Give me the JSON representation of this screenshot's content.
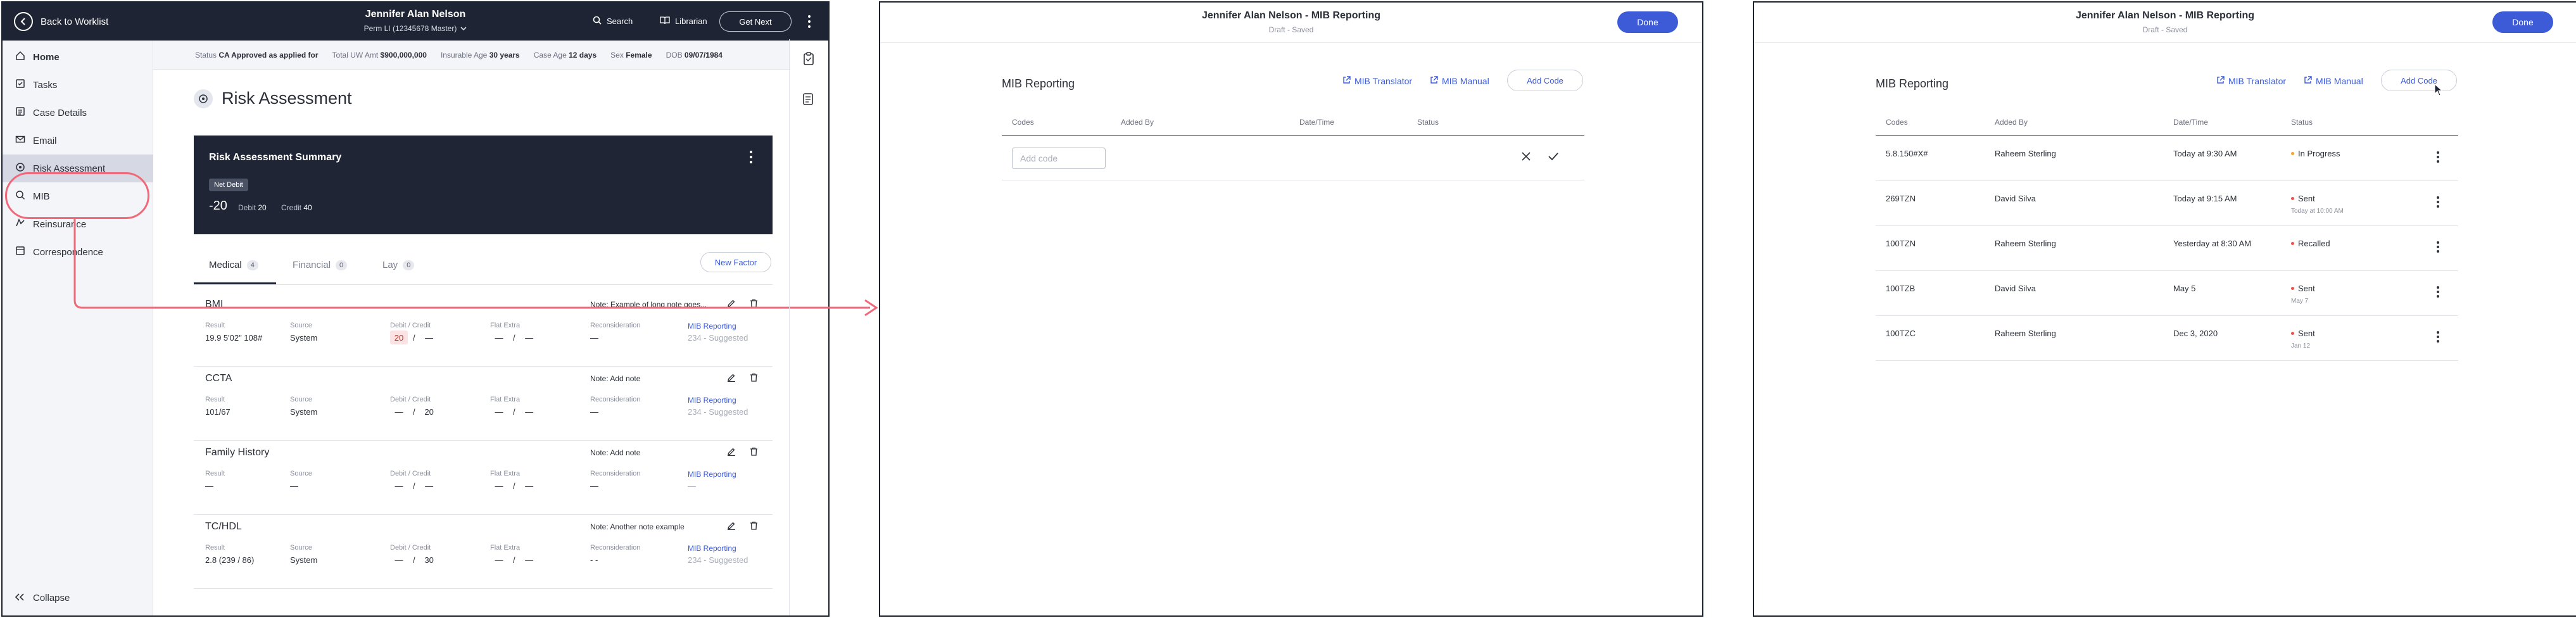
{
  "topbar": {
    "back_label": "Back to Worklist",
    "title": "Jennifer Alan Nelson",
    "subtitle": "Perm LI (12345678 Master)",
    "search_label": "Search",
    "librarian_label": "Librarian",
    "get_next_label": "Get Next"
  },
  "sidebar": {
    "items": [
      {
        "label": "Home",
        "icon": "home-icon"
      },
      {
        "label": "Tasks",
        "icon": "tasks-icon"
      },
      {
        "label": "Case Details",
        "icon": "case-details-icon"
      },
      {
        "label": "Email",
        "icon": "email-icon"
      },
      {
        "label": "Risk Assessment",
        "icon": "risk-assessment-icon"
      },
      {
        "label": "MIB",
        "icon": "search-icon"
      },
      {
        "label": "Reinsurance",
        "icon": "reinsurance-icon"
      },
      {
        "label": "Correspondence",
        "icon": "correspondence-icon"
      }
    ],
    "collapse_label": "Collapse"
  },
  "infobar": {
    "status_label": "Status",
    "status_value": "CA Approved as applied for",
    "uw_label": "Total UW Amt",
    "uw_value": "$900,000,000",
    "age_label": "Insurable Age",
    "age_value": "30 years",
    "caseage_label": "Case Age",
    "caseage_value": "12 days",
    "sex_label": "Sex",
    "sex_value": "Female",
    "dob_label": "DOB",
    "dob_value": "09/07/1984"
  },
  "risk": {
    "title": "Risk Assessment",
    "summary_title": "Risk Assessment Summary",
    "net_badge": "Net Debit",
    "total": "-20",
    "debit_label": "Debit",
    "debit_value": "20",
    "credit_label": "Credit",
    "credit_value": "40",
    "tabs": [
      {
        "label": "Medical",
        "count": "4"
      },
      {
        "label": "Financial",
        "count": "0"
      },
      {
        "label": "Lay",
        "count": "0"
      }
    ],
    "new_factor_label": "New Factor",
    "col_labels": {
      "result": "Result",
      "source": "Source",
      "debit_credit": "Debit / Credit",
      "flat_extra": "Flat Extra",
      "reconsideration": "Reconsideration"
    },
    "factors": [
      {
        "name": "BMI",
        "note": "Note: Example of long note goes...",
        "result": "19.9 5'02\" 108#",
        "source": "System",
        "debit": "20",
        "credit": "—",
        "flat1": "—",
        "flat2": "—",
        "recon": "—",
        "link": "MIB Reporting",
        "link_sub": "234 - Suggested"
      },
      {
        "name": "CCTA",
        "note": "Note: Add note",
        "result": "101/67",
        "source": "System",
        "debit": "—",
        "credit": "20",
        "flat1": "—",
        "flat2": "—",
        "recon": "—",
        "link": "MIB Reporting",
        "link_sub": "234 - Suggested"
      },
      {
        "name": "Family History",
        "note": "Note: Add note",
        "result": "—",
        "source": "—",
        "debit": "—",
        "credit": "—",
        "flat1": "—",
        "flat2": "—",
        "recon": "—",
        "link": "MIB Reporting",
        "link_sub": "—"
      },
      {
        "name": "TC/HDL",
        "note": "Note: Another note example",
        "result": "2.8 (239 / 86)",
        "source": "System",
        "debit": "—",
        "credit": "30",
        "flat1": "—",
        "flat2": "—",
        "recon": "- -",
        "link": "MIB Reporting",
        "link_sub": "234 - Suggested"
      }
    ]
  },
  "mib": {
    "window_title": "Jennifer Alan Nelson - MIB Reporting",
    "window_sub": "Draft - Saved",
    "done_label": "Done",
    "title": "MIB Reporting",
    "translator_label": "MIB Translator",
    "manual_label": "MIB Manual",
    "add_code_label": "Add Code",
    "headers": {
      "codes": "Codes",
      "added_by": "Added By",
      "datetime": "Date/Time",
      "status": "Status"
    },
    "add_placeholder": "Add code",
    "rows": [
      {
        "code": "5.8.150#X#",
        "added_by": "Raheem Sterling",
        "datetime": "Today at 9:30 AM",
        "status": "In Progress",
        "status_color": "#f0a23a",
        "status_sub": ""
      },
      {
        "code": "269TZN",
        "added_by": "David Silva",
        "datetime": "Today at 9:15 AM",
        "status": "Sent",
        "status_color": "#e8554e",
        "status_sub": "Today at 10:00 AM"
      },
      {
        "code": "100TZN",
        "added_by": "Raheem Sterling",
        "datetime": "Yesterday at 8:30 AM",
        "status": "Recalled",
        "status_color": "#e8554e",
        "status_sub": ""
      },
      {
        "code": "100TZB",
        "added_by": "David Silva",
        "datetime": "May 5",
        "status": "Sent",
        "status_color": "#e8554e",
        "status_sub": "May 7"
      },
      {
        "code": "100TZC",
        "added_by": "Raheem Sterling",
        "datetime": "Dec 3, 2020",
        "status": "Sent",
        "status_color": "#e8554e",
        "status_sub": "Jan 12"
      }
    ]
  },
  "colors": {
    "accent": "#3d5bd6",
    "dark": "#1e2433",
    "highlight": "#f0697a"
  }
}
